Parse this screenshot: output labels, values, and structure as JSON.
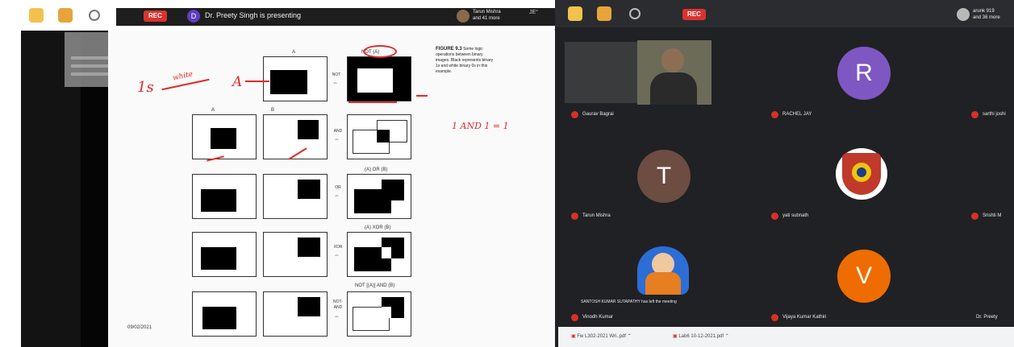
{
  "left": {
    "recording_label": "REC",
    "presenter_initial": "D",
    "presenting_text": "Dr. Preety Singh is presenting",
    "top_user_line1": "Tarun Mishra",
    "top_user_line2": "and 41 more"
  },
  "slide": {
    "top_col_label": "A",
    "col_a_label": "A",
    "col_b_label": "B",
    "rows": [
      {
        "op": "NOT",
        "result_label": "NOT (A)"
      },
      {
        "op": "AND",
        "result_label": "(A) AND (B)"
      },
      {
        "op": "OR",
        "result_label": "(A) OR (B)"
      },
      {
        "op": "XOR",
        "result_label": "(A) XOR (B)"
      },
      {
        "op": "NOT-AND",
        "result_label": "NOT [(A)] AND (B)"
      }
    ],
    "caption_title": "FIGURE 9.3",
    "caption_body": "Some logic operations between binary images. Black represents binary 1s and white binary 0s in this example.",
    "ink_1s": "1s",
    "ink_white": "white",
    "ink_a": "A",
    "ink_and": "1 AND 1 = 1",
    "date": "09/02/2021"
  },
  "right": {
    "recording_label": "REC",
    "top_user_line1": "arunk 919",
    "top_user_line2": "and 36 more",
    "participants": [
      {
        "name": "Gaurav Bagrai",
        "avatar_letter": ""
      },
      {
        "name": "RACHEL JAY",
        "avatar_letter": "R",
        "color": "#7e57c2"
      },
      {
        "name": "sarthi joshi",
        "avatar_letter": ""
      },
      {
        "name": "Tarun Mishra",
        "avatar_letter": "T",
        "color": "#6d4c41"
      },
      {
        "name": "yati subnath",
        "avatar_letter": ""
      },
      {
        "name": "Srishti M",
        "avatar_letter": ""
      },
      {
        "name": "Vinodh Kumar",
        "avatar_letter": ""
      },
      {
        "name": "Vijaya Kumar Kathiri",
        "avatar_letter": "V",
        "color": "#ef6c00"
      },
      {
        "name": "Dr. Preety",
        "avatar_letter": ""
      }
    ],
    "left_meeting_notice": "SANTOSH KUMAR SUTAPATHY has left the meeting",
    "downloads": [
      "Fw L302-2021 Wri..pdf",
      "Lab6 10-12-2021.pdf"
    ]
  },
  "colors": {
    "recording": "#d8332f",
    "presenter": "#5b3fc0",
    "ink": "#e02a2a",
    "meet_bg": "#202124"
  }
}
